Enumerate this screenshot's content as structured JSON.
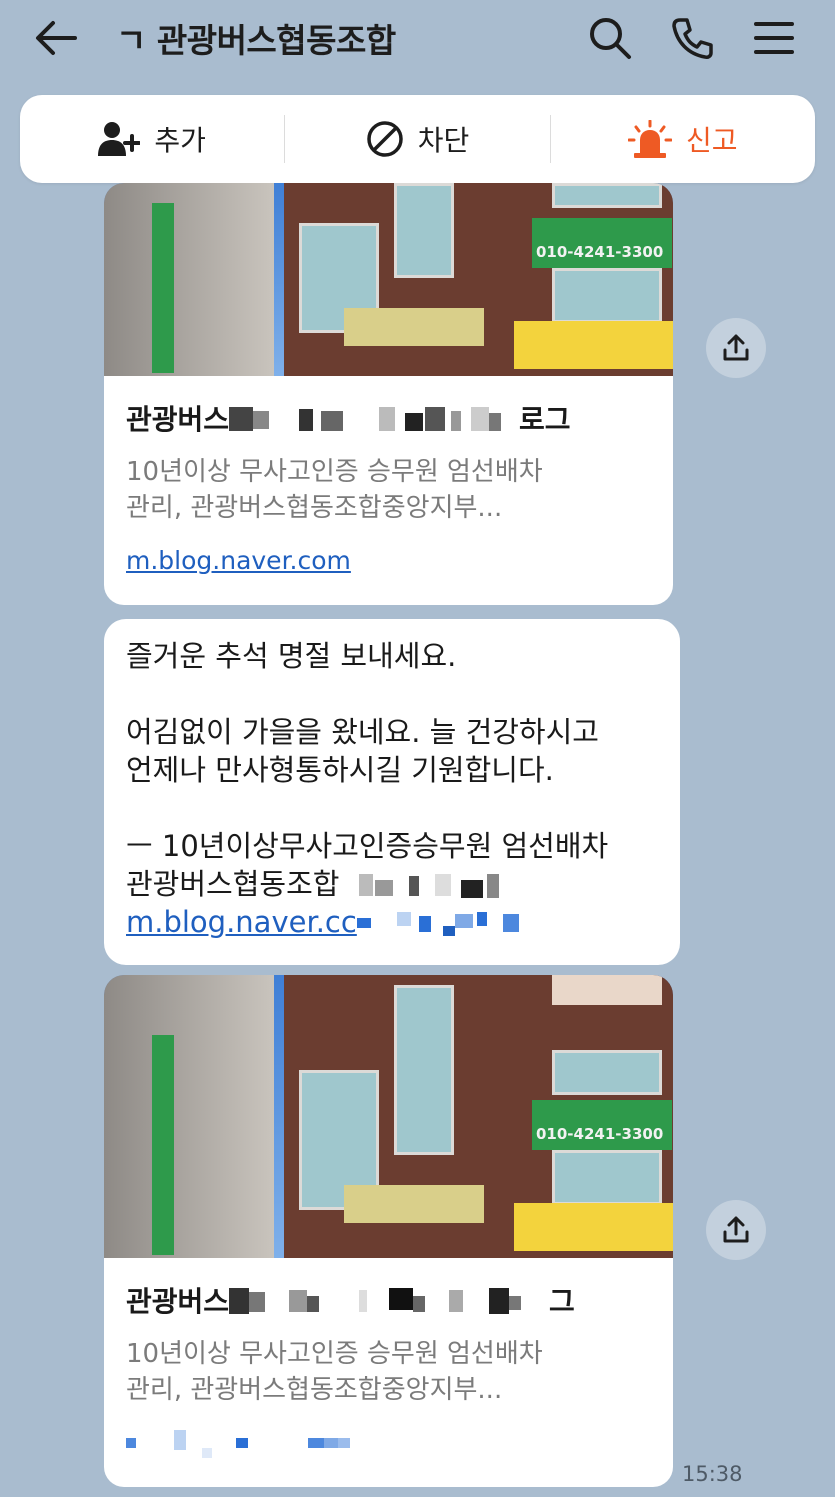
{
  "header": {
    "title": "ㄱ 관광버스협동조합"
  },
  "actions": [
    {
      "label": "추가"
    },
    {
      "label": "차단"
    },
    {
      "label": "신고"
    }
  ],
  "cards": [
    {
      "title": "관광버스",
      "title_suffix": "로그",
      "description_line1": "10년이상 무사고인증 승무원 엄선배차",
      "description_line2": "관리, 관광버스협동조합중앙지부...",
      "link": "m.blog.naver.com",
      "image_sign_phone": "010-4241-3300"
    },
    {
      "title": "관광버스",
      "title_suffix": "그",
      "description_line1": "10년이상 무사고인증 승무원 엄선배차",
      "description_line2": "관리, 관광버스협동조합중앙지부...",
      "image_sign_phone": "010-4241-3300"
    }
  ],
  "message": {
    "line1": "즐거운 추석 명절 보내세요.",
    "line2": "어김없이 가을을 왔네요.  늘 건강하시고",
    "line3": "언제나 만사형통하시길 기원합니다.",
    "line4": "ㅡ 10년이상무사고인증승무원 엄선배차",
    "line5": "관광버스협동조합",
    "link": "m.blog.naver.cc"
  },
  "timestamp": "15:38",
  "colors": {
    "background": "#a9bccf",
    "link": "#1f5fbf",
    "report": "#ee5a24"
  }
}
